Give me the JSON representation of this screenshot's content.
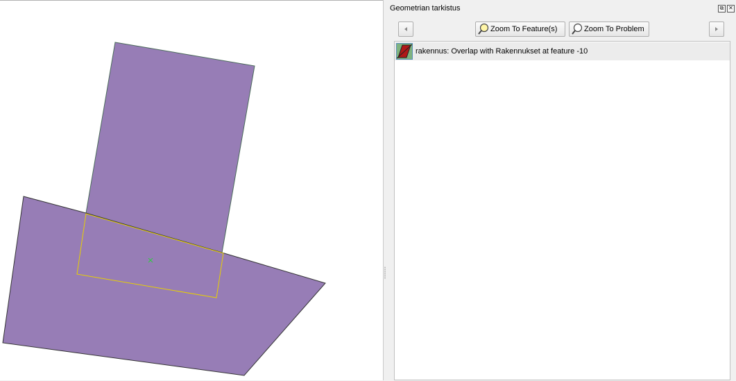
{
  "dock": {
    "title": "Geometrian tarkistus",
    "float_glyph": "⧉",
    "close_glyph": "✕",
    "toolbar": {
      "zoom_feature_label": "Zoom To Feature(s)",
      "zoom_problem_label": "Zoom To Problem"
    },
    "results": [
      {
        "label": "rakennus: Overlap with Rakennukset at feature -10"
      }
    ]
  },
  "colors": {
    "polygon_fill": "#977db6",
    "polygon_stroke": "#3c3c3c",
    "highlight_stroke": "#e8d000",
    "marker": "#2ecc40"
  }
}
